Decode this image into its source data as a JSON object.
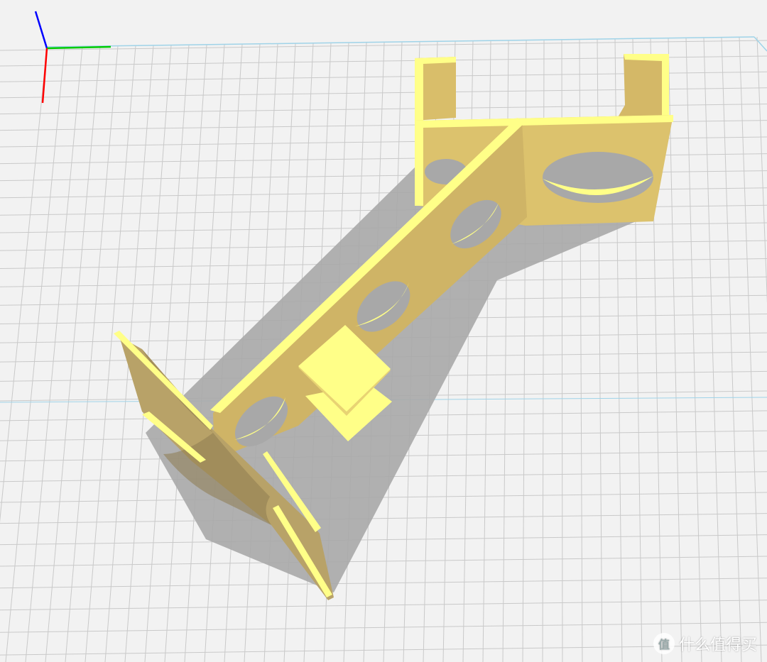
{
  "viewport": {
    "background": "#f2f2f2",
    "grid_color": "#c9c9c9",
    "bed_edge_color": "#9fd3e8",
    "axis_colors": {
      "x": "#ff0000",
      "y": "#00cc00",
      "z": "#0000ff"
    }
  },
  "model": {
    "face_light": "#ffff88",
    "face_mid": "#f0e070",
    "face_dark": "#c9b060",
    "shadow_color": "#a0a0a0"
  },
  "watermark": {
    "logo_glyph": "值",
    "text": "什么值得买"
  }
}
